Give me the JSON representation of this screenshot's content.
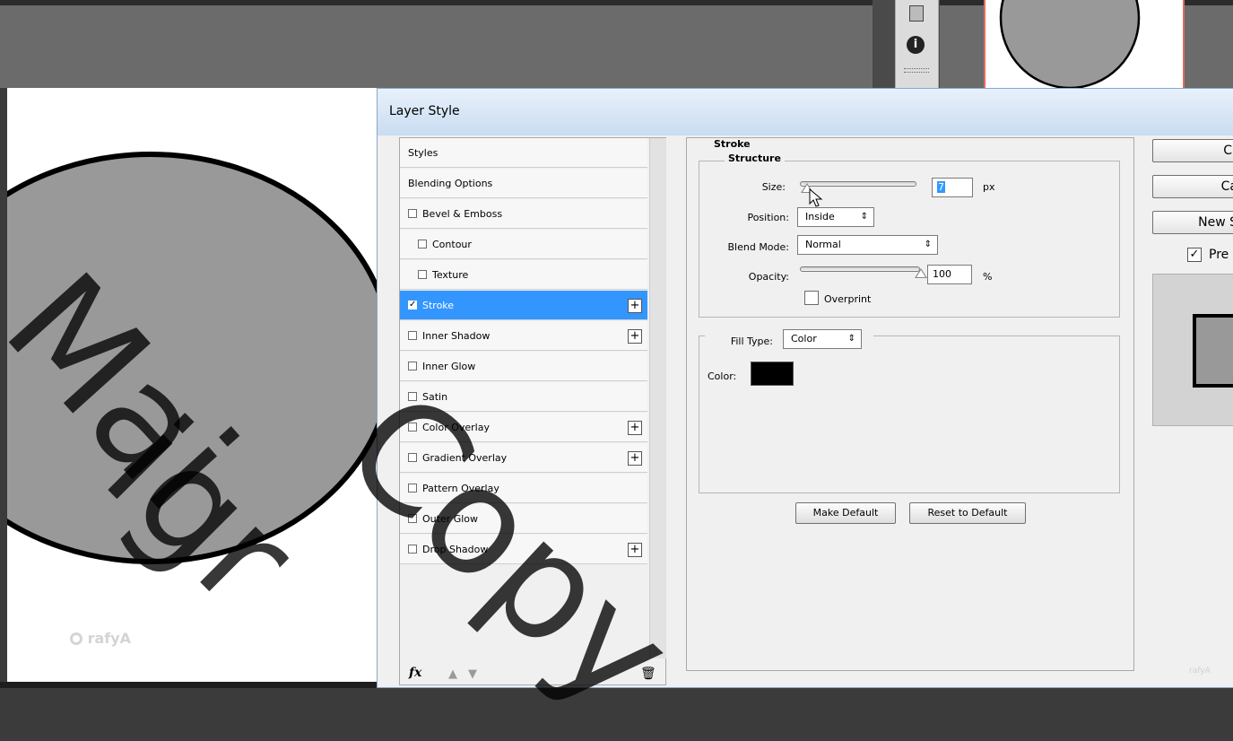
{
  "dialog": {
    "title": "Layer Style",
    "style_list": [
      {
        "label": "Styles",
        "checkbox": false,
        "checked": false,
        "plus": false,
        "selected": false,
        "indent": false
      },
      {
        "label": "Blending Options",
        "checkbox": false,
        "checked": false,
        "plus": false,
        "selected": false,
        "indent": false
      },
      {
        "label": "Bevel & Emboss",
        "checkbox": true,
        "checked": false,
        "plus": false,
        "selected": false,
        "indent": false
      },
      {
        "label": "Contour",
        "checkbox": true,
        "checked": false,
        "plus": false,
        "selected": false,
        "indent": true
      },
      {
        "label": "Texture",
        "checkbox": true,
        "checked": false,
        "plus": false,
        "selected": false,
        "indent": true
      },
      {
        "label": "Stroke",
        "checkbox": true,
        "checked": true,
        "plus": true,
        "selected": true,
        "indent": false
      },
      {
        "label": "Inner Shadow",
        "checkbox": true,
        "checked": false,
        "plus": true,
        "selected": false,
        "indent": false
      },
      {
        "label": "Inner Glow",
        "checkbox": true,
        "checked": false,
        "plus": false,
        "selected": false,
        "indent": false
      },
      {
        "label": "Satin",
        "checkbox": true,
        "checked": false,
        "plus": false,
        "selected": false,
        "indent": false
      },
      {
        "label": "Color Overlay",
        "checkbox": true,
        "checked": false,
        "plus": true,
        "selected": false,
        "indent": false
      },
      {
        "label": "Gradient Overlay",
        "checkbox": true,
        "checked": false,
        "plus": true,
        "selected": false,
        "indent": false
      },
      {
        "label": "Pattern Overlay",
        "checkbox": true,
        "checked": false,
        "plus": false,
        "selected": false,
        "indent": false
      },
      {
        "label": "Outer Glow",
        "checkbox": true,
        "checked": false,
        "plus": false,
        "selected": false,
        "indent": false
      },
      {
        "label": "Drop Shadow",
        "checkbox": true,
        "checked": false,
        "plus": true,
        "selected": false,
        "indent": false
      }
    ],
    "footer": {
      "fx_label": "fx"
    },
    "stroke": {
      "section_title": "Stroke",
      "structure_title": "Structure",
      "size_label": "Size:",
      "size_value": "7",
      "size_unit": "px",
      "size_slider_level": 0.05,
      "position_label": "Position:",
      "position_value": "Inside",
      "blend_mode_label": "Blend Mode:",
      "blend_mode_value": "Normal",
      "opacity_label": "Opacity:",
      "opacity_value": "100",
      "opacity_unit": "%",
      "opacity_slider_level": 1.0,
      "overprint_label": "Overprint",
      "overprint_checked": false,
      "fill_type_label": "Fill Type:",
      "fill_type_value": "Color",
      "color_label": "Color:",
      "color_swatch": "#000000",
      "make_default_label": "Make Default",
      "reset_default_label": "Reset to Default"
    },
    "right_buttons": {
      "ok_label": "C",
      "cancel_label": "Ca",
      "new_style_label": "New S",
      "preview_label": "Pre",
      "preview_checked": true
    },
    "small_watermark": "rafyA"
  },
  "canvas": {
    "watermark_logo_text": "rafyA",
    "circle_fill": "#999999",
    "stroke_color": "#000000"
  },
  "overlay_watermark": {
    "line1": "Mai",
    "line2": "igr",
    "line3": "Copy"
  },
  "colors": {
    "selection": "#3396ff",
    "guide": "#e86b5a"
  }
}
